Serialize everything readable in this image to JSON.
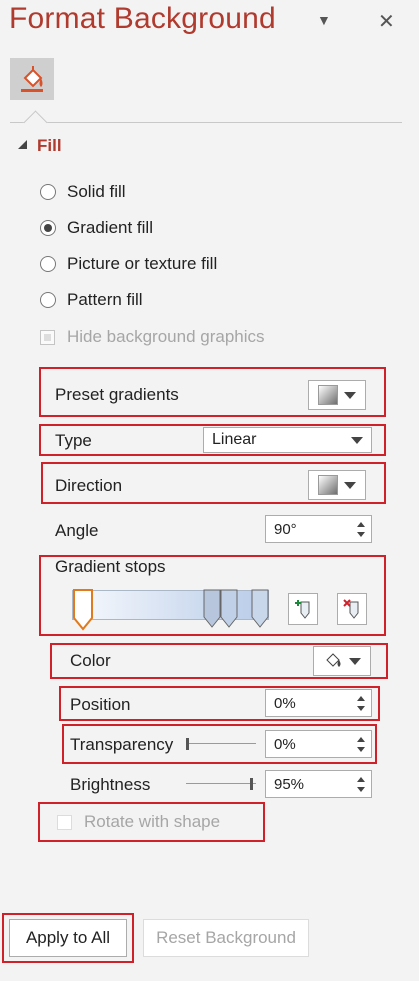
{
  "pane": {
    "title": "Format Background",
    "options_glyph": "▼",
    "close_glyph": "✕",
    "tab_icon": "fill-bucket-icon"
  },
  "fill": {
    "header": "Fill",
    "options": [
      {
        "label": "Solid fill",
        "selected": false
      },
      {
        "label": "Gradient fill",
        "selected": true
      },
      {
        "label": "Picture or texture fill",
        "selected": false
      },
      {
        "label": "Pattern fill",
        "selected": false
      }
    ],
    "hide_background_graphics": "Hide background graphics"
  },
  "gradient": {
    "preset_label": "Preset gradients",
    "type_label": "Type",
    "type_value": "Linear",
    "direction_label": "Direction",
    "angle_label": "Angle",
    "angle_value": "90°",
    "stops_label": "Gradient stops",
    "color_label": "Color",
    "position_label": "Position",
    "position_value": "0%",
    "transparency_label": "Transparency",
    "transparency_value": "0%",
    "transparency_level": 0,
    "brightness_label": "Brightness",
    "brightness_value": "95%",
    "brightness_level": 0.95,
    "rotate_label": "Rotate with shape"
  },
  "buttons": {
    "apply_all": "Apply to All",
    "reset": "Reset Background"
  },
  "colors": {
    "accent": "#b03a2e",
    "highlight_box": "#d0202a"
  }
}
